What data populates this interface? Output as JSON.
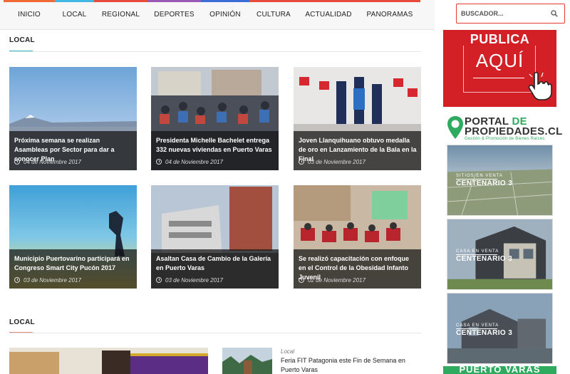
{
  "nav": {
    "items": [
      {
        "label": "INICIO",
        "color": "#f06a34"
      },
      {
        "label": "LOCAL",
        "color": "#3fb8e6"
      },
      {
        "label": "REGIONAL",
        "color": "#e84b3c"
      },
      {
        "label": "DEPORTES",
        "color": "#9b59b6"
      },
      {
        "label": "OPINIÓN",
        "color": "#3b6cd9"
      },
      {
        "label": "CULTURA",
        "color": "#e84b3c"
      },
      {
        "label": "ACTUALIDAD",
        "color": "#e84b3c"
      },
      {
        "label": "PANORAMAS",
        "color": "#e84b3c"
      }
    ]
  },
  "search": {
    "placeholder": "BUSCADOR..."
  },
  "section1": {
    "title": "LOCAL",
    "accent": "#35b7c9"
  },
  "cards": [
    {
      "title": "Próxima semana se realizan Asambleas por Sector para dar a conocer Plan",
      "date": "04 de Noviembre 2017"
    },
    {
      "title": "Presidenta Michelle Bachelet entrega 332 nuevas viviendas en Puerto Varas",
      "date": "04 de Noviembre 2017"
    },
    {
      "title": "Joven Llanquihuano obtuvo medalla de oro en Lanzamiento de la Bala en la Final",
      "date": "03 de Noviembre 2017"
    },
    {
      "title": "Municipio Puertovarino participará en Congreso Smart City Pucón 2017",
      "date": "03 de Noviembre 2017"
    },
    {
      "title": "Asaltan Casa de Cambio de la Galería en Puerto Varas",
      "date": "03 de Noviembre 2017"
    },
    {
      "title": "Se realizó capacitación con enfoque en el Control de la Obesidad Infanto Juvenil",
      "date": "02 de Noviembre 2017"
    }
  ],
  "section2": {
    "title": "LOCAL",
    "accent": "#e88a7a"
  },
  "bottom": {
    "category": "Local",
    "title": "Feria FIT Patagonia este Fin de Semana en Puerto Varas"
  },
  "ads": {
    "publica_top": "PUBLICA",
    "publica_bottom": "AQUÍ",
    "portal_line1a": "PORTAL ",
    "portal_line1b": "DE",
    "portal_line2": "PROPIEDADES.CL",
    "portal_tagline": "Gestión & Promoción de Bienes Raíces",
    "props": [
      {
        "sub": "SITIOS EN VENTA",
        "main": "CENTENARIO 3"
      },
      {
        "sub": "CASA EN VENTA",
        "main": "CENTENARIO 3"
      },
      {
        "sub": "CASA EN VENTA",
        "main": "CENTENARIO 3"
      }
    ],
    "pv": "PUERTO VARAS"
  },
  "colors": {
    "accent_red": "#d32027",
    "portal_green": "#2eab5f"
  }
}
